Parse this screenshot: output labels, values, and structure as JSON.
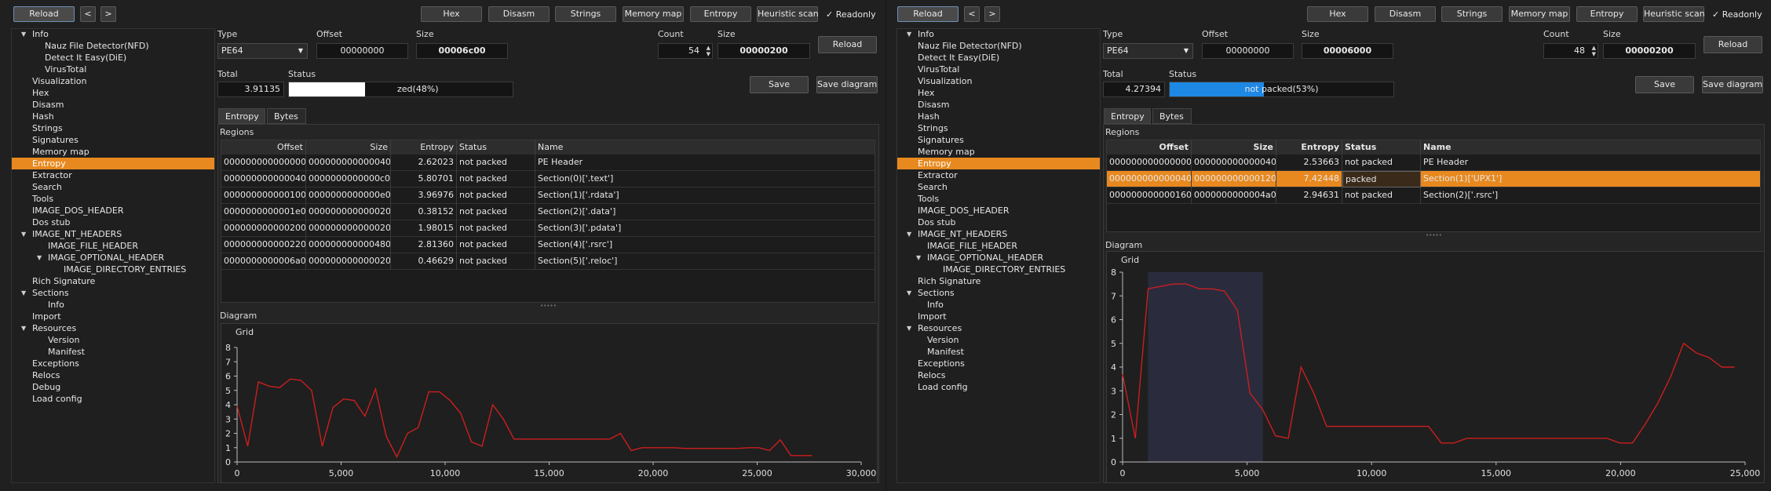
{
  "toolbar": {
    "reload": "Reload",
    "back": "<",
    "forward": ">",
    "hex": "Hex",
    "disasm": "Disasm",
    "strings": "Strings",
    "memory_map": "Memory map",
    "entropy": "Entropy",
    "heuristic_scan": "Heuristic scan",
    "readonly_check": "✓",
    "readonly": "Readonly"
  },
  "tree": {
    "items": [
      "Info",
      "Nauz File Detector(NFD)",
      "Detect It Easy(DiE)",
      "VirusTotal",
      "Visualization",
      "Hex",
      "Disasm",
      "Hash",
      "Strings",
      "Signatures",
      "Memory map",
      "Entropy",
      "Extractor",
      "Search",
      "Tools",
      "IMAGE_DOS_HEADER",
      "Dos stub",
      "IMAGE_NT_HEADERS",
      "IMAGE_FILE_HEADER",
      "IMAGE_OPTIONAL_HEADER",
      "IMAGE_DIRECTORY_ENTRIES",
      "Rich Signature",
      "Sections",
      "Info",
      "Import",
      "Resources",
      "Version",
      "Manifest",
      "Exceptions",
      "Relocs",
      "Debug",
      "Load config"
    ],
    "items_right": [
      "Info",
      "Nauz File Detector(NFD)",
      "Detect It Easy(DiE)",
      "VirusTotal",
      "Visualization",
      "Hex",
      "Disasm",
      "Hash",
      "Strings",
      "Signatures",
      "Memory map",
      "Entropy",
      "Extractor",
      "Search",
      "Tools",
      "IMAGE_DOS_HEADER",
      "Dos stub",
      "IMAGE_NT_HEADERS",
      "IMAGE_FILE_HEADER",
      "IMAGE_OPTIONAL_HEADER",
      "IMAGE_DIRECTORY_ENTRIES",
      "Rich Signature",
      "Sections",
      "Info",
      "Import",
      "Resources",
      "Version",
      "Manifest",
      "Exceptions",
      "Relocs",
      "Load config"
    ]
  },
  "labels": {
    "type": "Type",
    "offset": "Offset",
    "size": "Size",
    "count": "Count",
    "total": "Total",
    "status": "Status",
    "reload": "Reload",
    "save": "Save",
    "save_diagram": "Save diagram",
    "tab_entropy": "Entropy",
    "tab_bytes": "Bytes",
    "regions": "Regions",
    "diagram": "Diagram",
    "grid": "Grid",
    "col_offset": "Offset",
    "col_size": "Size",
    "col_entropy": "Entropy",
    "col_status": "Status",
    "col_name": "Name"
  },
  "left": {
    "type": "PE64",
    "offset": "00000000",
    "size": "00006c00",
    "count": "54",
    "block_size": "00000200",
    "total": "3.91135",
    "status_text": "zed(48%)",
    "progress": 0.48,
    "rows": [
      [
        "0000000000000000",
        "0000000000000400",
        "2.62023",
        "not packed",
        "PE Header"
      ],
      [
        "0000000000000400",
        "0000000000000c00",
        "5.80701",
        "not packed",
        "Section(0)['.text']"
      ],
      [
        "0000000000001000",
        "0000000000000e00",
        "3.96976",
        "not packed",
        "Section(1)['.rdata']"
      ],
      [
        "0000000000001e00",
        "0000000000000200",
        "0.38152",
        "not packed",
        "Section(2)['.data']"
      ],
      [
        "0000000000002000",
        "0000000000000200",
        "1.98015",
        "not packed",
        "Section(3)['.pdata']"
      ],
      [
        "0000000000002200",
        "0000000000004800",
        "2.81360",
        "not packed",
        "Section(4)['.rsrc']"
      ],
      [
        "0000000000006a00",
        "0000000000000200",
        "0.46629",
        "not packed",
        "Section(5)['.reloc']"
      ]
    ]
  },
  "right": {
    "type": "PE64",
    "offset": "00000000",
    "size": "00006000",
    "count": "48",
    "block_size": "00000200",
    "total": "4.27394",
    "status_text": "not packed(53%)",
    "progress": 0.53,
    "rows": [
      [
        "0000000000000000",
        "0000000000000400",
        "2.53663",
        "not packed",
        "PE Header"
      ],
      [
        "0000000000000400",
        "0000000000001200",
        "7.42448",
        "packed",
        "Section(1)['UPX1']"
      ],
      [
        "0000000000001600",
        "0000000000004a00",
        "2.94631",
        "not packed",
        "Section(2)['.rsrc']"
      ]
    ]
  },
  "chart_data": [
    {
      "type": "line",
      "title": "Grid",
      "xlim": [
        0,
        30000
      ],
      "ylim": [
        0,
        8
      ],
      "xticks": [
        "0",
        "5,000",
        "10,000",
        "15,000",
        "20,000",
        "25,000",
        "30,000"
      ],
      "yticks": [
        "0",
        "1",
        "2",
        "3",
        "4",
        "5",
        "6",
        "7",
        "8"
      ],
      "color": "#cc1e1e",
      "series": [
        {
          "x": [
            0,
            512,
            1024,
            1536,
            2048,
            2560,
            3072,
            3584,
            4096,
            4608,
            5120,
            5632,
            6144,
            6656,
            7168,
            7680,
            8192,
            8704,
            9216,
            9728,
            10240,
            10752,
            11264,
            11776,
            12288,
            12800,
            13312,
            13824,
            14336,
            14848,
            15360,
            15872,
            16384,
            16896,
            17408,
            17920,
            18432,
            18944,
            19456,
            19968,
            20480,
            20992,
            21504,
            22016,
            22528,
            23040,
            23552,
            24064,
            24576,
            25088,
            25600,
            26112,
            26624,
            27136,
            27648
          ],
          "y": [
            3.9,
            1.1,
            5.6,
            5.3,
            5.2,
            5.8,
            5.7,
            5.0,
            1.1,
            3.8,
            4.4,
            4.3,
            3.2,
            5.1,
            1.8,
            0.35,
            2.0,
            2.4,
            4.9,
            4.9,
            4.3,
            3.4,
            1.4,
            1.1,
            4.0,
            3.0,
            1.6,
            1.6,
            1.6,
            1.6,
            1.6,
            1.6,
            1.6,
            1.6,
            1.6,
            1.6,
            2.0,
            0.8,
            1.0,
            1.0,
            1.0,
            1.0,
            0.95,
            0.95,
            0.95,
            0.95,
            0.95,
            0.95,
            1.0,
            1.0,
            0.8,
            1.55,
            0.45,
            0.45,
            0.45
          ]
        }
      ]
    },
    {
      "type": "line",
      "title": "Grid",
      "xlim": [
        0,
        25000
      ],
      "ylim": [
        0,
        8
      ],
      "xticks": [
        "0",
        "5,000",
        "10,000",
        "15,000",
        "20,000",
        "25,000"
      ],
      "yticks": [
        "0",
        "1",
        "2",
        "3",
        "4",
        "5",
        "6",
        "7",
        "8"
      ],
      "color": "#cc1e1e",
      "highlight_range": [
        1024,
        5632
      ],
      "series": [
        {
          "x": [
            0,
            512,
            1024,
            1536,
            2048,
            2560,
            3072,
            3584,
            4096,
            4608,
            5120,
            5632,
            6144,
            6656,
            7168,
            7680,
            8192,
            8704,
            9216,
            9728,
            10240,
            10752,
            11264,
            11776,
            12288,
            12800,
            13312,
            13824,
            14336,
            14848,
            15360,
            15872,
            16384,
            16896,
            17408,
            17920,
            18432,
            18944,
            19456,
            19968,
            20480,
            20992,
            21504,
            22016,
            22528,
            23040,
            23552,
            24064,
            24576
          ],
          "y": [
            3.7,
            1.0,
            7.3,
            7.4,
            7.5,
            7.5,
            7.3,
            7.3,
            7.2,
            6.4,
            2.9,
            2.2,
            1.1,
            1.0,
            4.0,
            2.9,
            1.5,
            1.5,
            1.5,
            1.5,
            1.5,
            1.5,
            1.5,
            1.5,
            1.5,
            0.8,
            0.8,
            1.0,
            1.0,
            1.0,
            1.0,
            1.0,
            1.0,
            1.0,
            1.0,
            1.0,
            1.0,
            1.0,
            1.0,
            0.8,
            0.8,
            1.6,
            2.5,
            3.6,
            5.0,
            4.6,
            4.4,
            4.0,
            4.0
          ]
        }
      ]
    }
  ]
}
